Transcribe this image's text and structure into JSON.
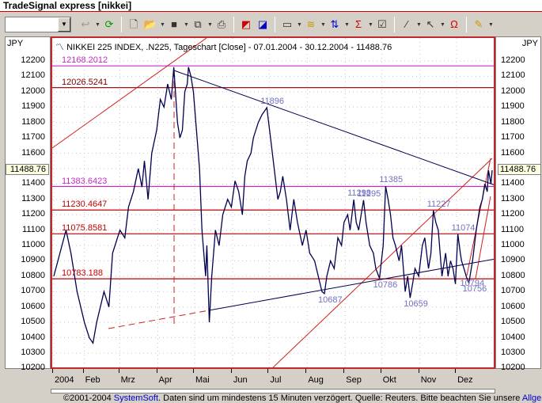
{
  "window": {
    "title": "TradeSignal express [nikkei]"
  },
  "toolbar": {
    "symbol_value": "",
    "icons": [
      "link-icon",
      "refresh-icon",
      "new-icon",
      "open-icon",
      "save-icon",
      "copy-icon",
      "print-icon",
      "chart-back-icon",
      "chart-forward-icon",
      "window-icon",
      "indicator-icon",
      "strategy-icon",
      "formula-icon",
      "properties-icon",
      "draw-line-icon",
      "pointer-icon",
      "magnet-icon",
      "help-icon"
    ]
  },
  "axis": {
    "unit_left": "JPY",
    "unit_right": "JPY",
    "current_value": "11488.76",
    "ticks": [
      "12200",
      "12100",
      "12000",
      "11900",
      "11800",
      "11700",
      "11600",
      "11500",
      "11400",
      "11300",
      "11200",
      "11100",
      "11000",
      "10900",
      "10800",
      "10700",
      "10600",
      "10500",
      "10400",
      "10300",
      "10200"
    ]
  },
  "chart_data": {
    "type": "line",
    "title": "NIKKEI 225 INDEX, .N225, Tageschart [Close] - 07.01.2004 - 30.12.2004 - 11488.76",
    "xlabel": "",
    "ylabel": "JPY",
    "ylim": [
      10200,
      12300
    ],
    "xlim": [
      7,
      365
    ],
    "x_unit": "day of year 2004",
    "month_labels": [
      {
        "label": "2004",
        "day": 7
      },
      {
        "label": "Feb",
        "day": 32
      },
      {
        "label": "Mrz",
        "day": 61
      },
      {
        "label": "Apr",
        "day": 92
      },
      {
        "label": "Mai",
        "day": 122
      },
      {
        "label": "Jun",
        "day": 153
      },
      {
        "label": "Jul",
        "day": 183
      },
      {
        "label": "Aug",
        "day": 214
      },
      {
        "label": "Sep",
        "day": 245
      },
      {
        "label": "Okt",
        "day": 275
      },
      {
        "label": "Nov",
        "day": 306
      },
      {
        "label": "Dez",
        "day": 336
      }
    ],
    "series": [
      {
        "name": "Close",
        "color": "#000050",
        "points": [
          [
            7,
            10800
          ],
          [
            12,
            10950
          ],
          [
            17,
            11100
          ],
          [
            21,
            10950
          ],
          [
            26,
            10700
          ],
          [
            32,
            10500
          ],
          [
            36,
            10400
          ],
          [
            39,
            10365
          ],
          [
            42,
            10500
          ],
          [
            48,
            10700
          ],
          [
            52,
            10600
          ],
          [
            55,
            10950
          ],
          [
            61,
            11100
          ],
          [
            65,
            11050
          ],
          [
            68,
            11250
          ],
          [
            72,
            11350
          ],
          [
            76,
            11500
          ],
          [
            79,
            11380
          ],
          [
            81,
            11550
          ],
          [
            84,
            11300
          ],
          [
            87,
            11600
          ],
          [
            91,
            11750
          ],
          [
            94,
            11950
          ],
          [
            97,
            11900
          ],
          [
            100,
            12050
          ],
          [
            103,
            11950
          ],
          [
            105,
            12160
          ],
          [
            108,
            11800
          ],
          [
            110,
            11700
          ],
          [
            112,
            11750
          ],
          [
            114,
            12000
          ],
          [
            116,
            12050
          ],
          [
            117,
            12160
          ],
          [
            119,
            12100
          ],
          [
            121,
            12000
          ],
          [
            124,
            11700
          ],
          [
            126,
            11500
          ],
          [
            128,
            11100
          ],
          [
            130,
            10900
          ],
          [
            131,
            10800
          ],
          [
            132,
            11000
          ],
          [
            134,
            10500
          ],
          [
            136,
            10800
          ],
          [
            139,
            11100
          ],
          [
            142,
            11000
          ],
          [
            145,
            11200
          ],
          [
            149,
            11300
          ],
          [
            152,
            11250
          ],
          [
            155,
            11420
          ],
          [
            158,
            11350
          ],
          [
            161,
            11200
          ],
          [
            163,
            11450
          ],
          [
            165,
            11550
          ],
          [
            168,
            11600
          ],
          [
            170,
            11700
          ],
          [
            174,
            11800
          ],
          [
            177,
            11850
          ],
          [
            181,
            11896
          ],
          [
            184,
            11700
          ],
          [
            187,
            11500
          ],
          [
            190,
            11300
          ],
          [
            192,
            11350
          ],
          [
            194,
            11450
          ],
          [
            197,
            11300
          ],
          [
            200,
            11100
          ],
          [
            203,
            11300
          ],
          [
            206,
            11150
          ],
          [
            210,
            11000
          ],
          [
            213,
            11100
          ],
          [
            216,
            10950
          ],
          [
            220,
            10900
          ],
          [
            223,
            10800
          ],
          [
            226,
            10700
          ],
          [
            228,
            10687
          ],
          [
            230,
            10800
          ],
          [
            233,
            10900
          ],
          [
            236,
            10850
          ],
          [
            239,
            11050
          ],
          [
            242,
            11000
          ],
          [
            244,
            11150
          ],
          [
            247,
            11200
          ],
          [
            249,
            11100
          ],
          [
            252,
            11298
          ],
          [
            254,
            11150
          ],
          [
            256,
            11100
          ],
          [
            258,
            11200
          ],
          [
            260,
            11295
          ],
          [
            262,
            11150
          ],
          [
            265,
            11000
          ],
          [
            268,
            10950
          ],
          [
            270,
            10850
          ],
          [
            273,
            10786
          ],
          [
            276,
            11000
          ],
          [
            278,
            11385
          ],
          [
            280,
            11300
          ],
          [
            282,
            11200
          ],
          [
            284,
            11050
          ],
          [
            286,
            11000
          ],
          [
            289,
            10900
          ],
          [
            291,
            11000
          ],
          [
            294,
            10700
          ],
          [
            296,
            10800
          ],
          [
            298,
            10659
          ],
          [
            300,
            10750
          ],
          [
            302,
            10850
          ],
          [
            305,
            10800
          ],
          [
            308,
            11000
          ],
          [
            310,
            11050
          ],
          [
            313,
            10850
          ],
          [
            315,
            10950
          ],
          [
            317,
            11227
          ],
          [
            319,
            11150
          ],
          [
            321,
            11100
          ],
          [
            324,
            10800
          ],
          [
            327,
            10950
          ],
          [
            329,
            10800
          ],
          [
            331,
            10900
          ],
          [
            333,
            10850
          ],
          [
            335,
            10750
          ],
          [
            337,
            11074
          ],
          [
            339,
            10950
          ],
          [
            340,
            10900
          ],
          [
            342,
            10850
          ],
          [
            344,
            10794
          ],
          [
            346,
            10756
          ],
          [
            349,
            10900
          ],
          [
            352,
            11100
          ],
          [
            355,
            11250
          ],
          [
            357,
            11300
          ],
          [
            359,
            11400
          ],
          [
            361,
            11350
          ],
          [
            362,
            11489
          ],
          [
            364,
            11400
          ],
          [
            365,
            11489
          ]
        ]
      }
    ],
    "data_labels": [
      {
        "text": "11896",
        "day": 181,
        "value": 11896
      },
      {
        "text": "10687",
        "day": 228,
        "value": 10687
      },
      {
        "text": "11298",
        "day": 252,
        "value": 11298
      },
      {
        "text": "11295",
        "day": 260,
        "value": 11295
      },
      {
        "text": "10786",
        "day": 273,
        "value": 10786
      },
      {
        "text": "11385",
        "day": 278,
        "value": 11385
      },
      {
        "text": "10659",
        "day": 298,
        "value": 10659
      },
      {
        "text": "11227",
        "day": 317,
        "value": 11227
      },
      {
        "text": "11074",
        "day": 337,
        "value": 11074
      },
      {
        "text": "10794",
        "day": 344,
        "value": 10794
      },
      {
        "text": "10756",
        "day": 346,
        "value": 10756
      }
    ],
    "levels": [
      {
        "text": "12168.2012",
        "value": 12168.2012,
        "color": "#c030c0"
      },
      {
        "text": "12026.5241",
        "value": 12026.5241,
        "color": "#800000"
      },
      {
        "text": "11383.6423",
        "value": 11383.6423,
        "color": "#c030c0"
      },
      {
        "text": "11230.4647",
        "value": 11230.4647,
        "color": "#c00000"
      },
      {
        "text": "11075.8581",
        "value": 11075.8581,
        "color": "#c00000"
      },
      {
        "text": "10783.188",
        "value": 10783.188,
        "color": "#c00000"
      }
    ],
    "grid": true,
    "legend": "none"
  },
  "footer": {
    "copyright": "©2001-2004 ",
    "company": "SystemSoft",
    "text": ". Daten sind um mindestens 15 Minuten verzögert. Quelle: Reuters. Bitte beachten Sie unsere ",
    "link": "Allgemein"
  }
}
